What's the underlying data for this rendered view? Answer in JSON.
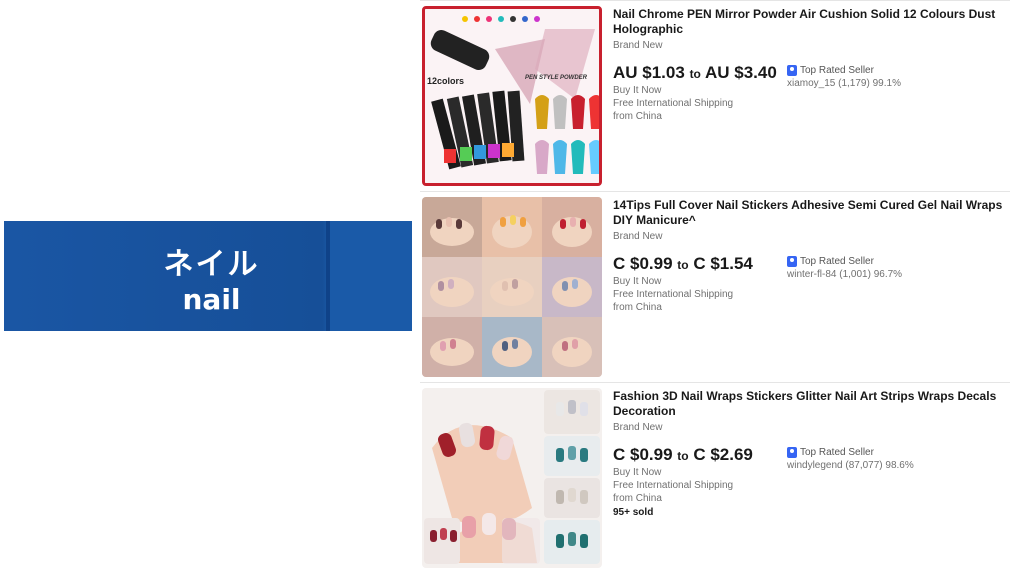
{
  "banner": {
    "jp": "ネイル",
    "en": "nail"
  },
  "items": [
    {
      "title": "Nail Chrome PEN Mirror Powder Air Cushion Solid 12 Colours Dust Holographic",
      "condition": "Brand New",
      "price_low": "AU $1.03",
      "price_to": "to",
      "price_high": "AU $3.40",
      "buy": "Buy It Now",
      "shipping": "Free International Shipping from China",
      "badge": "Top Rated Seller",
      "seller": "xiamoy_15 (1,179) 99.1%",
      "thumb_text_left": "12colors",
      "thumb_text_right": "PEN STYLE POWDER",
      "sold": ""
    },
    {
      "title": "14Tips Full Cover Nail Stickers Adhesive Semi Cured Gel Nail Wraps DIY Manicure^",
      "condition": "Brand New",
      "price_low": "C $0.99",
      "price_to": "to",
      "price_high": "C $1.54",
      "buy": "Buy It Now",
      "shipping": "Free International Shipping from China",
      "badge": "Top Rated Seller",
      "seller": "winter-fl-84 (1,001) 96.7%",
      "sold": ""
    },
    {
      "title": "Fashion 3D Nail Wraps Stickers Glitter Nail Art Strips Wraps Decals Decoration",
      "condition": "Brand New",
      "price_low": "C $0.99",
      "price_to": "to",
      "price_high": "C $2.69",
      "buy": "Buy It Now",
      "shipping": "Free International Shipping from China",
      "badge": "Top Rated Seller",
      "seller": "windylegend (87,077) 98.6%",
      "sold": "95+ sold"
    }
  ]
}
